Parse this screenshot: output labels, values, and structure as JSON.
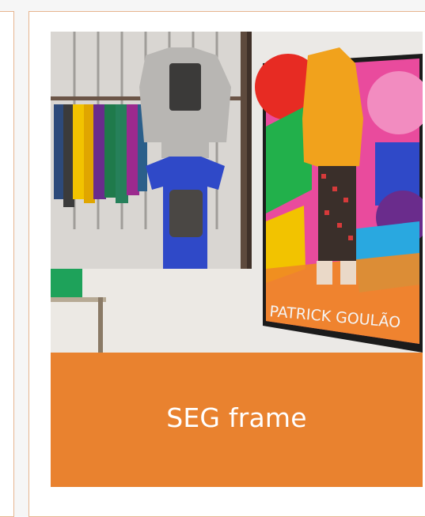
{
  "card": {
    "caption": "SEG frame",
    "image_alt": "Retail store with clothing racks and a fabric frame poster",
    "poster_text": "PATRICK GOULÃO",
    "accent_color": "#e9822f",
    "border_color": "#e7b58f"
  }
}
